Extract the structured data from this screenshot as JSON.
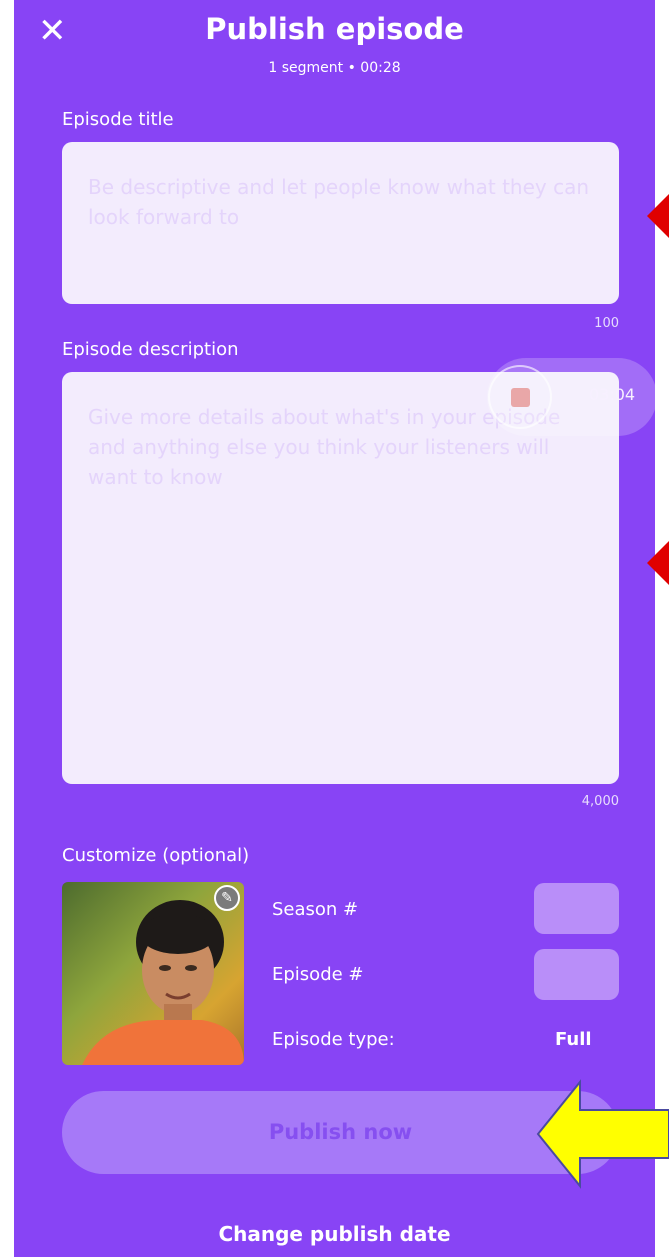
{
  "header": {
    "close_label": "✕",
    "title": "Publish episode",
    "subtitle": "1 segment • 00:28"
  },
  "episode_title": {
    "label": "Episode title",
    "placeholder": "Be descriptive and let people know what they can look forward to",
    "char_limit": "100"
  },
  "episode_description": {
    "label": "Episode description",
    "placeholder": "Give more details about what's in your episode and anything else you think your listeners will want to know",
    "char_limit": "4,000"
  },
  "recording_overlay": {
    "time": "03:04"
  },
  "customize": {
    "label": "Customize (optional)",
    "season_label": "Season #",
    "episode_label": "Episode #",
    "episode_type_label": "Episode type:",
    "episode_type_value": "Full"
  },
  "actions": {
    "publish_now": "Publish now",
    "change_publish_date": "Change publish date"
  },
  "colors": {
    "background": "#8844f5",
    "field": "#f3ecfd",
    "publish_button": "#a679f8",
    "annotation_marker": "#e00000",
    "annotation_arrow": "#ffff00"
  }
}
